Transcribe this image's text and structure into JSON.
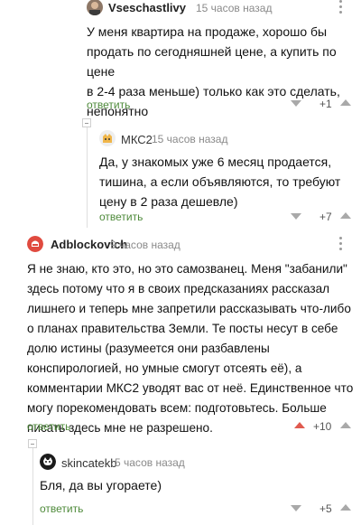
{
  "comments": [
    {
      "username": "Vseschastlivy",
      "time": "15 часов назад",
      "lines": [
        "У меня квартира на продаже, хорошо бы",
        "продать по сегодняшней цене, а купить по цене",
        "в 2-4 раза меньше) только как это сделать,",
        "непонятно"
      ],
      "reply_label": "ответить",
      "rating": "+1"
    },
    {
      "username": "МКС2",
      "time": "15 часов назад",
      "lines": [
        "Да, у знакомых уже 6 месяц продается,",
        "тишина, а если объявляются, то требуют",
        "цену в 2 раза дешевле)"
      ],
      "reply_label": "ответить",
      "rating": "+7"
    },
    {
      "username": "Adblockovich",
      "time": "9 часов назад",
      "lines": [
        "Я не знаю, кто это, но это самозванец. Меня \"забанили\"",
        "здесь потому что я в своих предсказаниях рассказал",
        "лишнего и теперь мне запретили рассказывать что-либо",
        "о планах правительства Земли. Те посты несут в себе",
        "долю истины (разумеется они разбавлены",
        "конспирологией, но умные смогут отсеять её), а",
        "комментарии МКС2 уводят вас от неё. Единственное что",
        "могу порекомендовать всем: подготовьтесь. Больше",
        "писать здесь мне не разрешено."
      ],
      "reply_label": "ответить",
      "rating": "+10"
    },
    {
      "username": "skincatekb",
      "time": "5 часов назад",
      "lines": [
        "Бля, да вы угораете)"
      ],
      "reply_label": "ответить",
      "rating": "+5"
    }
  ],
  "colors": {
    "reply": "#4e8a3a",
    "upvote_active": "#e05a4f",
    "meta": "#8a8a8a"
  },
  "icons": [
    "kebab-menu-icon",
    "downvote-arrow-icon",
    "upvote-arrow-icon",
    "collapse-thread-icon"
  ]
}
